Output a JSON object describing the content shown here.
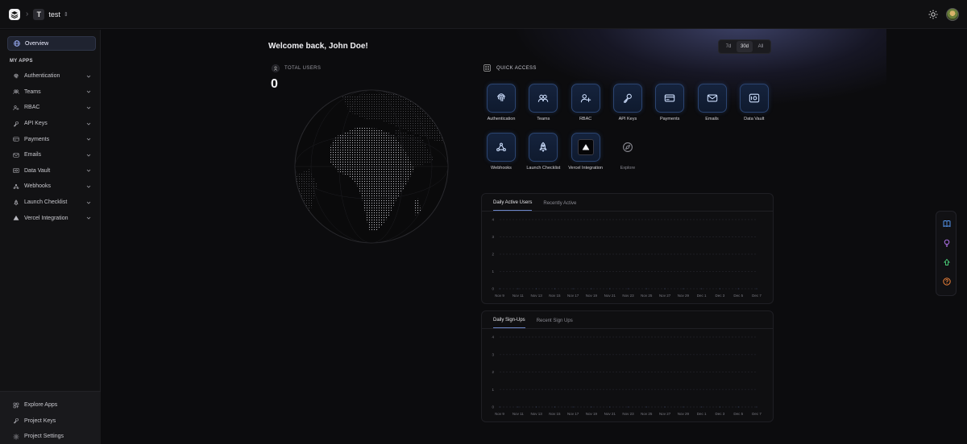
{
  "topbar": {
    "project_initial": "T",
    "project_name": "test"
  },
  "sidebar": {
    "overview_label": "Overview",
    "section_label": "MY APPS",
    "items": [
      {
        "label": "Authentication",
        "icon": "fingerprint-icon"
      },
      {
        "label": "Teams",
        "icon": "users-icon"
      },
      {
        "label": "RBAC",
        "icon": "user-key-icon"
      },
      {
        "label": "API Keys",
        "icon": "key-icon"
      },
      {
        "label": "Payments",
        "icon": "card-icon"
      },
      {
        "label": "Emails",
        "icon": "mail-icon"
      },
      {
        "label": "Data Vault",
        "icon": "vault-icon"
      },
      {
        "label": "Webhooks",
        "icon": "webhook-icon"
      },
      {
        "label": "Launch Checklist",
        "icon": "rocket-icon"
      },
      {
        "label": "Vercel Integration",
        "icon": "triangle-icon"
      }
    ],
    "bottom": [
      {
        "label": "Explore Apps",
        "icon": "explore-icon"
      },
      {
        "label": "Project Keys",
        "icon": "key-icon"
      },
      {
        "label": "Project Settings",
        "icon": "gear-icon"
      }
    ]
  },
  "main": {
    "welcome": "Welcome back, John Doe!",
    "ranges": [
      "7d",
      "30d",
      "All"
    ],
    "active_range": "30d",
    "total_users_label": "TOTAL USERS",
    "total_users_value": "0",
    "quick_access_label": "QUICK ACCESS",
    "quick_access": [
      {
        "label": "Authentication",
        "icon": "fingerprint-icon"
      },
      {
        "label": "Teams",
        "icon": "users-icon"
      },
      {
        "label": "RBAC",
        "icon": "user-key-icon"
      },
      {
        "label": "API Keys",
        "icon": "key-icon"
      },
      {
        "label": "Payments",
        "icon": "card-icon"
      },
      {
        "label": "Emails",
        "icon": "mail-icon"
      },
      {
        "label": "Data Vault",
        "icon": "vault-icon"
      },
      {
        "label": "Webhooks",
        "icon": "webhook-icon"
      },
      {
        "label": "Launch Checklist",
        "icon": "rocket-icon"
      },
      {
        "label": "Vercel Integration",
        "icon": "triangle-icon"
      },
      {
        "label": "Explore",
        "icon": "compass-icon"
      }
    ],
    "chart1": {
      "tabs": [
        "Daily Active Users",
        "Recently Active"
      ],
      "active_tab": "Daily Active Users"
    },
    "chart2": {
      "tabs": [
        "Daily Sign-Ups",
        "Recent Sign Ups"
      ],
      "active_tab": "Daily Sign-Ups"
    }
  },
  "colors": {
    "accent": "#6b86c8",
    "tile_border": "#2b4470",
    "background": "#0c0c0e"
  },
  "chart_data": [
    {
      "type": "line",
      "x": [
        "Nov 9",
        "Nov 11",
        "Nov 13",
        "Nov 15",
        "Nov 17",
        "Nov 19",
        "Nov 21",
        "Nov 23",
        "Nov 25",
        "Nov 27",
        "Nov 29",
        "Dec 1",
        "Dec 3",
        "Dec 5",
        "Dec 7"
      ],
      "y_ticks": [
        "4",
        "3",
        "2",
        "1",
        "0"
      ],
      "ylim": [
        0,
        4
      ],
      "series": [
        {
          "values": [
            0,
            0,
            0,
            0,
            0,
            0,
            0,
            0,
            0,
            0,
            0,
            0,
            0,
            0,
            0
          ]
        }
      ]
    },
    {
      "type": "line",
      "x": [
        "Nov 9",
        "Nov 11",
        "Nov 13",
        "Nov 15",
        "Nov 17",
        "Nov 19",
        "Nov 21",
        "Nov 23",
        "Nov 25",
        "Nov 27",
        "Nov 29",
        "Dec 1",
        "Dec 3",
        "Dec 5",
        "Dec 7"
      ],
      "y_ticks": [
        "4",
        "3",
        "2",
        "1",
        "0"
      ],
      "ylim": [
        0,
        4
      ],
      "series": [
        {
          "values": [
            0,
            0,
            0,
            0,
            0,
            0,
            0,
            0,
            0,
            0,
            0,
            0,
            0,
            0,
            0
          ]
        }
      ]
    }
  ]
}
